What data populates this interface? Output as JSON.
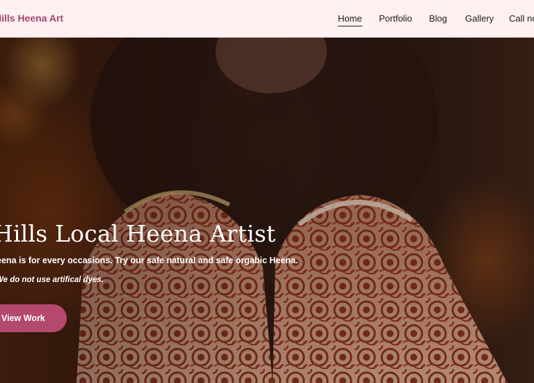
{
  "header": {
    "brand": "Hills Heena Art",
    "nav": [
      {
        "label": "Home",
        "active": true
      },
      {
        "label": "Portfolio",
        "active": false
      },
      {
        "label": "Blog",
        "active": false
      },
      {
        "label": "Gallery",
        "active": false
      },
      {
        "label": "Call now",
        "active": false
      }
    ]
  },
  "hero": {
    "title": "Hills Local Heena Artist",
    "subtitle": "Heena is for every occasions. Try our safe natural and safe orgabic Heena.",
    "note": "We do not use artifical dyes.",
    "cta_label": "View Work"
  },
  "colors": {
    "header_bg": "#fff0f1",
    "brand": "#a7456e",
    "cta_bg": "#b4486f",
    "henna": "#8a2a14"
  }
}
